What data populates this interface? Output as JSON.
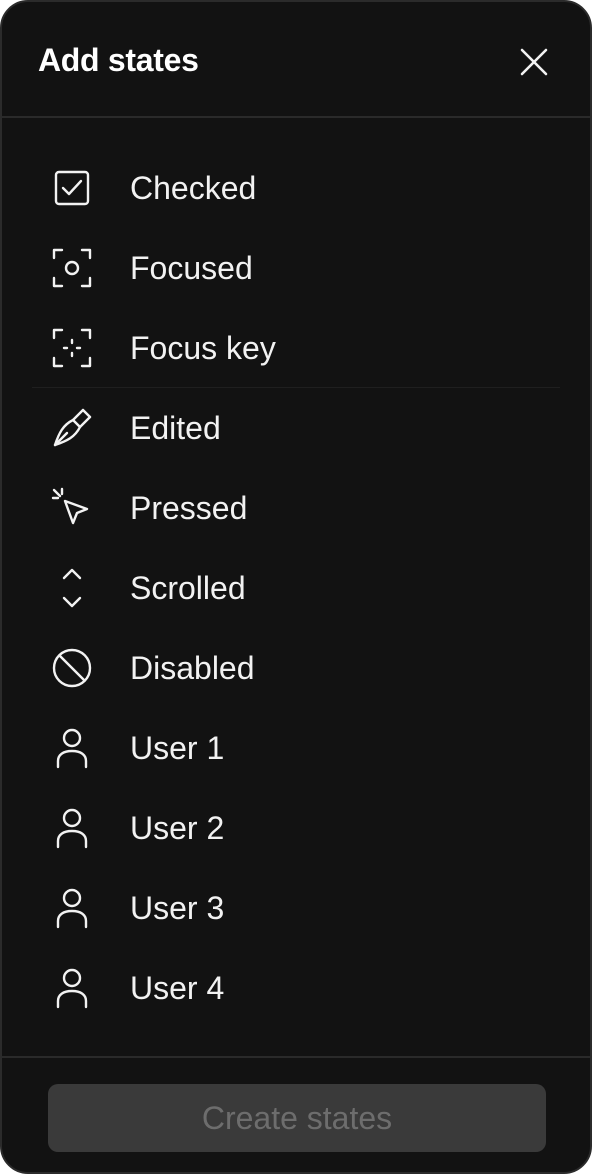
{
  "dialog": {
    "title": "Add states",
    "close_icon": "close-icon"
  },
  "states": [
    {
      "label": "Checked",
      "icon": "checkbox-checked-icon"
    },
    {
      "label": "Focused",
      "icon": "focus-frame-icon"
    },
    {
      "label": "Focus key",
      "icon": "focus-key-icon"
    },
    {
      "label": "Edited",
      "icon": "pen-nib-icon"
    },
    {
      "label": "Pressed",
      "icon": "cursor-click-icon"
    },
    {
      "label": "Scrolled",
      "icon": "scroll-chevrons-icon"
    },
    {
      "label": "Disabled",
      "icon": "prohibited-icon"
    },
    {
      "label": "User 1",
      "icon": "user-icon"
    },
    {
      "label": "User 2",
      "icon": "user-icon"
    },
    {
      "label": "User 3",
      "icon": "user-icon"
    },
    {
      "label": "User 4",
      "icon": "user-icon"
    }
  ],
  "footer": {
    "create_label": "Create states"
  },
  "colors": {
    "panel_bg": "#121212",
    "text": "#f2f2f2",
    "divider": "#2a2a2a",
    "button_disabled_bg": "#3a3a3a",
    "button_disabled_text": "#6d6d6d"
  }
}
